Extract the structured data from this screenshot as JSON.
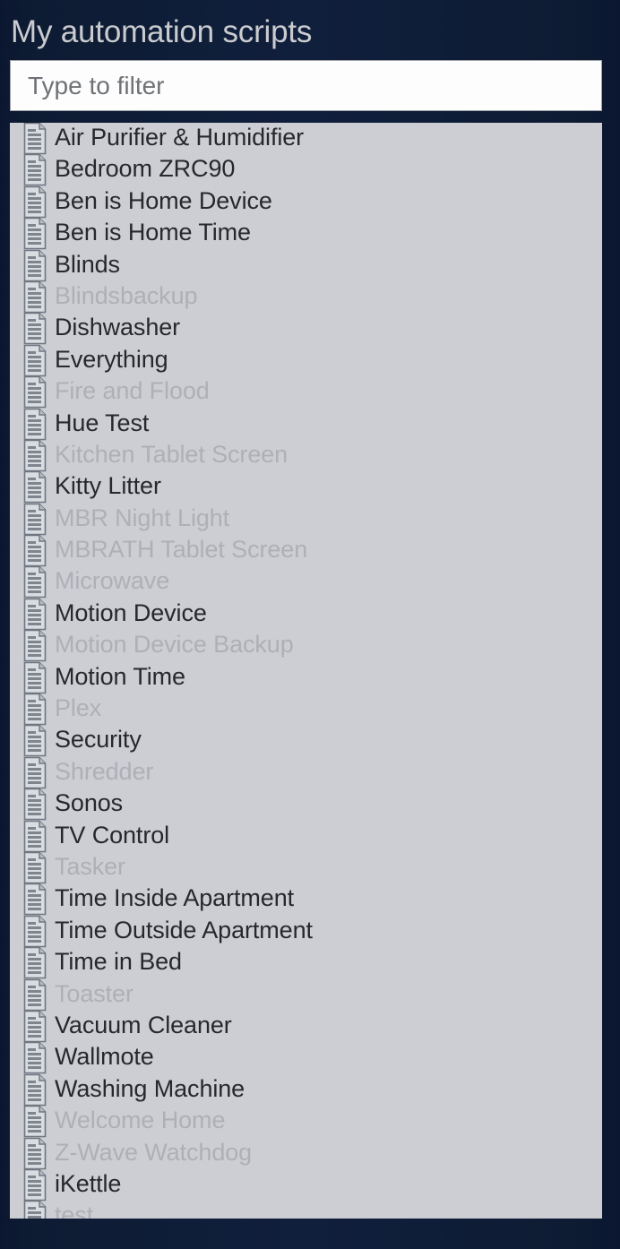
{
  "window": {
    "title": "My automation scripts",
    "background_color": "#0d1b33",
    "title_color": "#c9cbcf"
  },
  "filter": {
    "placeholder": "Type to filter",
    "value": "",
    "name": "filter-input"
  },
  "list": {
    "panel_background": "#ccced3",
    "enabled_text_color": "#26282c",
    "disabled_text_color": "#aeb0b6",
    "icon": "document-icon",
    "item_count": 35,
    "items": [
      {
        "label": "Air Purifier & Humidifier",
        "enabled": true
      },
      {
        "label": "Bedroom ZRC90",
        "enabled": true
      },
      {
        "label": "Ben is Home Device",
        "enabled": true
      },
      {
        "label": "Ben is Home Time",
        "enabled": true
      },
      {
        "label": "Blinds",
        "enabled": true
      },
      {
        "label": "Blindsbackup",
        "enabled": false
      },
      {
        "label": "Dishwasher",
        "enabled": true
      },
      {
        "label": "Everything",
        "enabled": true
      },
      {
        "label": "Fire and Flood",
        "enabled": false
      },
      {
        "label": "Hue Test",
        "enabled": true
      },
      {
        "label": "Kitchen Tablet Screen",
        "enabled": false
      },
      {
        "label": "Kitty Litter",
        "enabled": true
      },
      {
        "label": "MBR Night Light",
        "enabled": false
      },
      {
        "label": "MBRATH Tablet Screen",
        "enabled": false
      },
      {
        "label": "Microwave",
        "enabled": false
      },
      {
        "label": "Motion Device",
        "enabled": true
      },
      {
        "label": "Motion Device Backup",
        "enabled": false
      },
      {
        "label": "Motion Time",
        "enabled": true
      },
      {
        "label": "Plex",
        "enabled": false
      },
      {
        "label": "Security",
        "enabled": true
      },
      {
        "label": "Shredder",
        "enabled": false
      },
      {
        "label": "Sonos",
        "enabled": true
      },
      {
        "label": "TV Control",
        "enabled": true
      },
      {
        "label": "Tasker",
        "enabled": false
      },
      {
        "label": "Time Inside Apartment",
        "enabled": true
      },
      {
        "label": "Time Outside Apartment",
        "enabled": true
      },
      {
        "label": "Time in Bed",
        "enabled": true
      },
      {
        "label": "Toaster",
        "enabled": false
      },
      {
        "label": "Vacuum Cleaner",
        "enabled": true
      },
      {
        "label": "Wallmote",
        "enabled": true
      },
      {
        "label": "Washing Machine",
        "enabled": true
      },
      {
        "label": "Welcome Home",
        "enabled": false
      },
      {
        "label": "Z-Wave Watchdog",
        "enabled": false
      },
      {
        "label": "iKettle",
        "enabled": true
      },
      {
        "label": "test",
        "enabled": false
      }
    ]
  }
}
